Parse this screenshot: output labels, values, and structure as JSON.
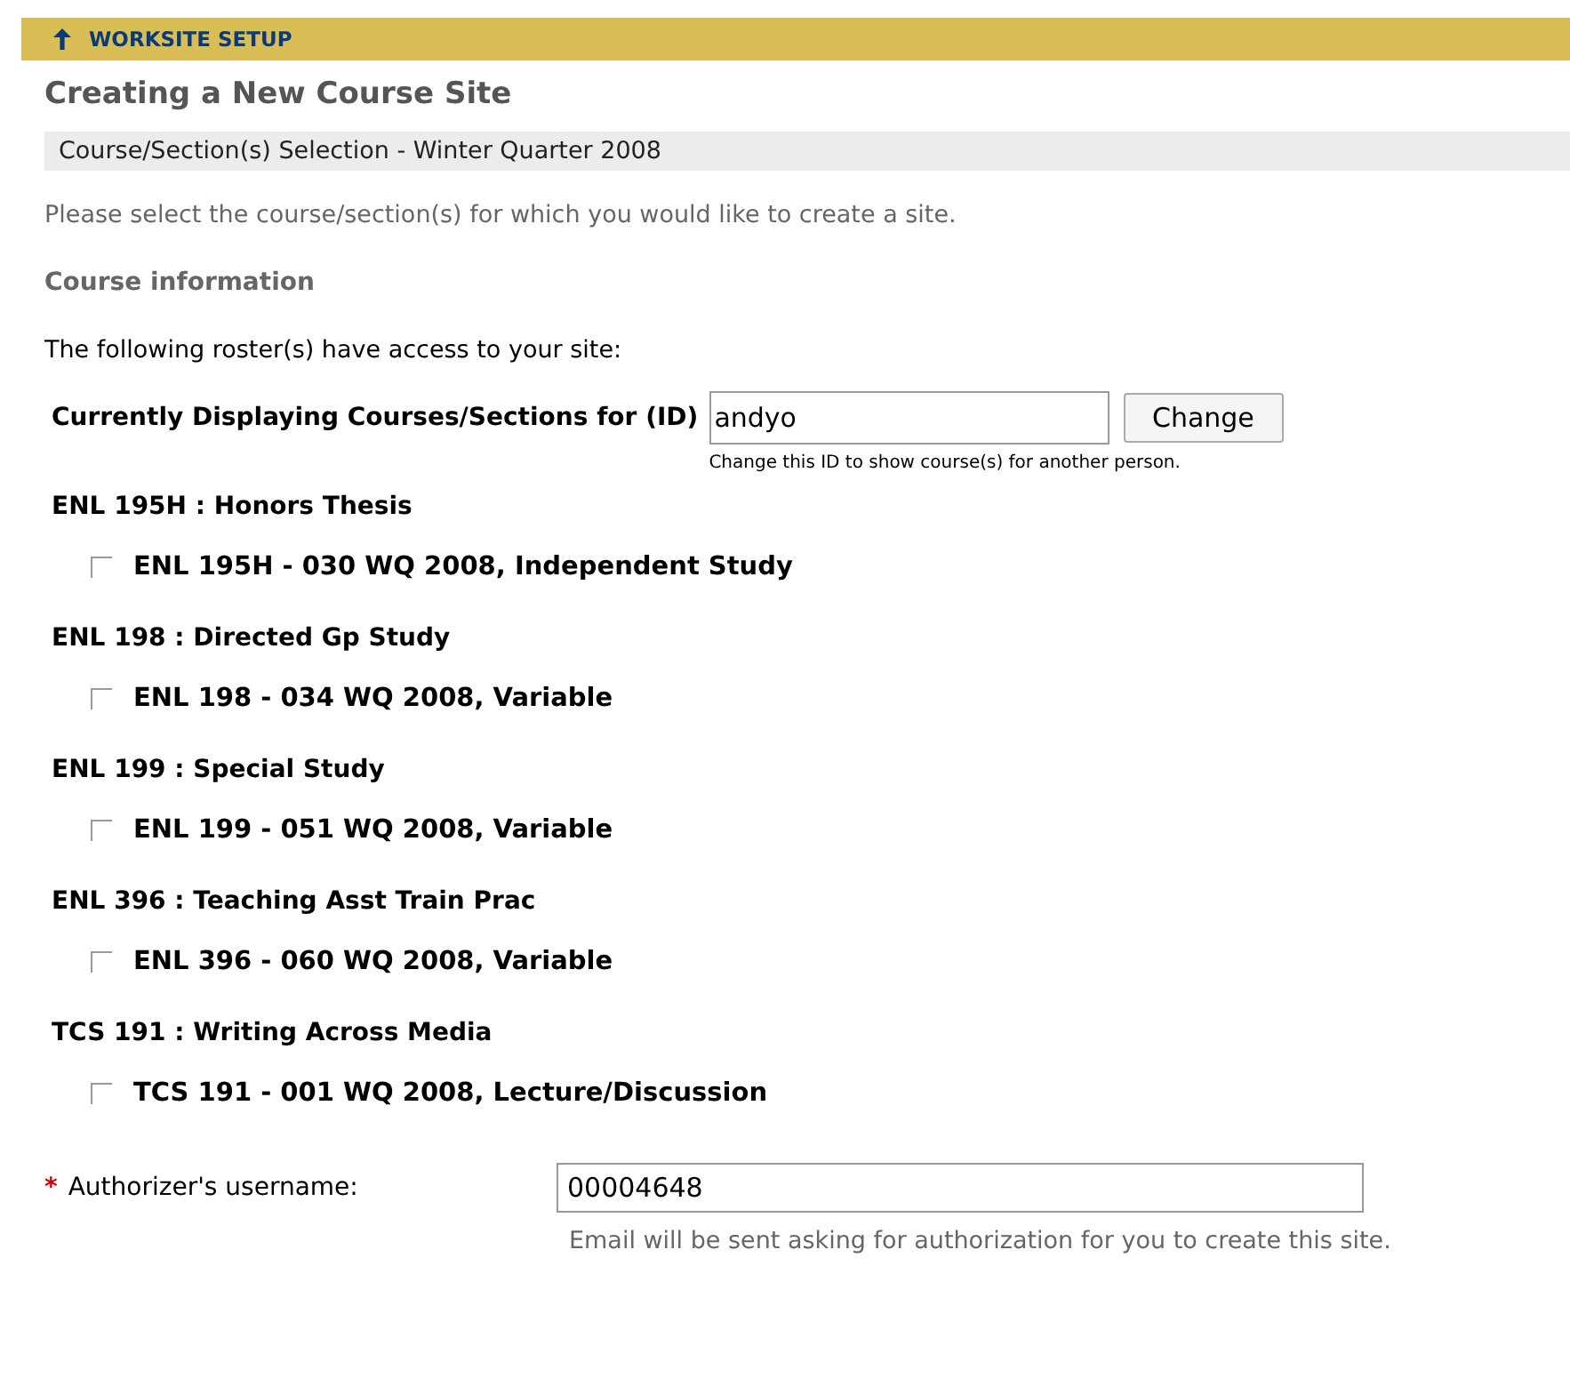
{
  "tool_bar": {
    "title": "WORKSITE SETUP"
  },
  "page_title": "Creating a New Course Site",
  "step_header": "Course/Section(s) Selection - Winter Quarter 2008",
  "instructions": "Please select the course/section(s) for which you would like to create a site.",
  "section_heading": "Course information",
  "roster_note": "The following roster(s) have access to your site:",
  "id_lookup": {
    "label": "Currently Displaying Courses/Sections for (ID)",
    "value": "andyo",
    "button": "Change",
    "hint": "Change this ID to show course(s) for another person."
  },
  "courses": [
    {
      "title": "ENL 195H : Honors Thesis",
      "sections": [
        {
          "label": "ENL 195H - 030 WQ 2008, Independent Study",
          "checked": false
        }
      ]
    },
    {
      "title": "ENL 198 : Directed Gp Study",
      "sections": [
        {
          "label": "ENL 198 - 034 WQ 2008, Variable",
          "checked": false
        }
      ]
    },
    {
      "title": "ENL 199 : Special Study",
      "sections": [
        {
          "label": "ENL 199 - 051 WQ 2008, Variable",
          "checked": false
        }
      ]
    },
    {
      "title": "ENL 396 : Teaching Asst Train Prac",
      "sections": [
        {
          "label": "ENL 396 - 060 WQ 2008, Variable",
          "checked": false
        }
      ]
    },
    {
      "title": "TCS 191 : Writing Across Media",
      "sections": [
        {
          "label": "TCS 191 - 001 WQ 2008, Lecture/Discussion",
          "checked": false
        }
      ]
    }
  ],
  "authorizer": {
    "required_mark": "*",
    "label": "Authorizer's username:",
    "value": "00004648",
    "hint": "Email will be sent asking for authorization for you to create this site."
  }
}
